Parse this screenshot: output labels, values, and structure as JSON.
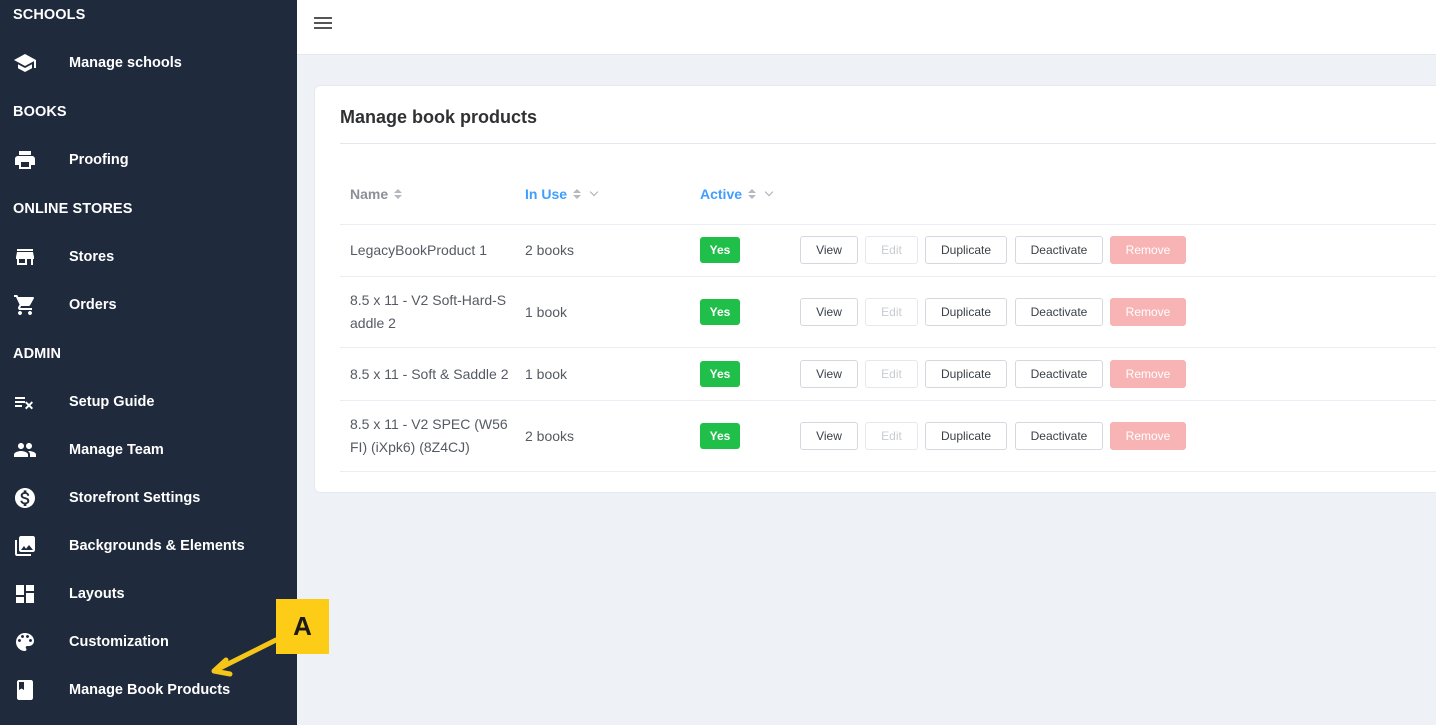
{
  "sidebar": {
    "sections": [
      {
        "title": "SCHOOLS"
      },
      {
        "title": "BOOKS"
      },
      {
        "title": "ONLINE STORES"
      },
      {
        "title": "ADMIN"
      }
    ],
    "items": [
      {
        "label": "Manage schools",
        "icon": "school-icon"
      },
      {
        "label": "Proofing",
        "icon": "printer-icon"
      },
      {
        "label": "Stores",
        "icon": "store-icon"
      },
      {
        "label": "Orders",
        "icon": "cart-icon"
      },
      {
        "label": "Setup Guide",
        "icon": "checklist-icon"
      },
      {
        "label": "Manage Team",
        "icon": "team-icon"
      },
      {
        "label": "Storefront Settings",
        "icon": "dollar-icon"
      },
      {
        "label": "Backgrounds & Elements",
        "icon": "images-icon"
      },
      {
        "label": "Layouts",
        "icon": "dashboard-icon"
      },
      {
        "label": "Customization",
        "icon": "palette-icon"
      },
      {
        "label": "Manage Book Products",
        "icon": "book-icon"
      }
    ]
  },
  "header": {
    "menu_icon": "hamburger-icon"
  },
  "main": {
    "title": "Manage book products",
    "columns": [
      {
        "label": "Name"
      },
      {
        "label": "In Use"
      },
      {
        "label": "Active"
      }
    ],
    "rows": [
      {
        "name": "LegacyBookProduct 1",
        "name_l1": "LegacyBookProduct 1",
        "name_l2": "",
        "in_use": "2 books",
        "active": "Yes"
      },
      {
        "name": "8.5 x 11 - V2 Soft-Hard-Saddle 2",
        "name_l1": "8.5 x 11 - V2 Soft-Hard-S",
        "name_l2": "addle 2",
        "in_use": "1 book",
        "active": "Yes"
      },
      {
        "name": "8.5 x 11 - Soft & Saddle 2",
        "name_l1": "8.5 x 11 - Soft & Saddle 2",
        "name_l2": "",
        "in_use": "1 book",
        "active": "Yes"
      },
      {
        "name": "8.5 x 11 - V2 SPEC (W56FI) (iXpk6) (8Z4CJ)",
        "name_l1": "8.5 x 11 - V2 SPEC (W56",
        "name_l2": "FI) (iXpk6) (8Z4CJ)",
        "in_use": "2 books",
        "active": "Yes"
      }
    ],
    "actions": {
      "view": "View",
      "edit": "Edit",
      "duplicate": "Duplicate",
      "deactivate": "Deactivate",
      "remove": "Remove"
    }
  },
  "annotation": {
    "label": "A"
  },
  "colors": {
    "sidebar_bg": "#1f2a3c",
    "accent": "#409eff",
    "active_badge": "#1fbf4a",
    "remove_btn": "#f8b4b4",
    "callout": "#fccc17"
  }
}
